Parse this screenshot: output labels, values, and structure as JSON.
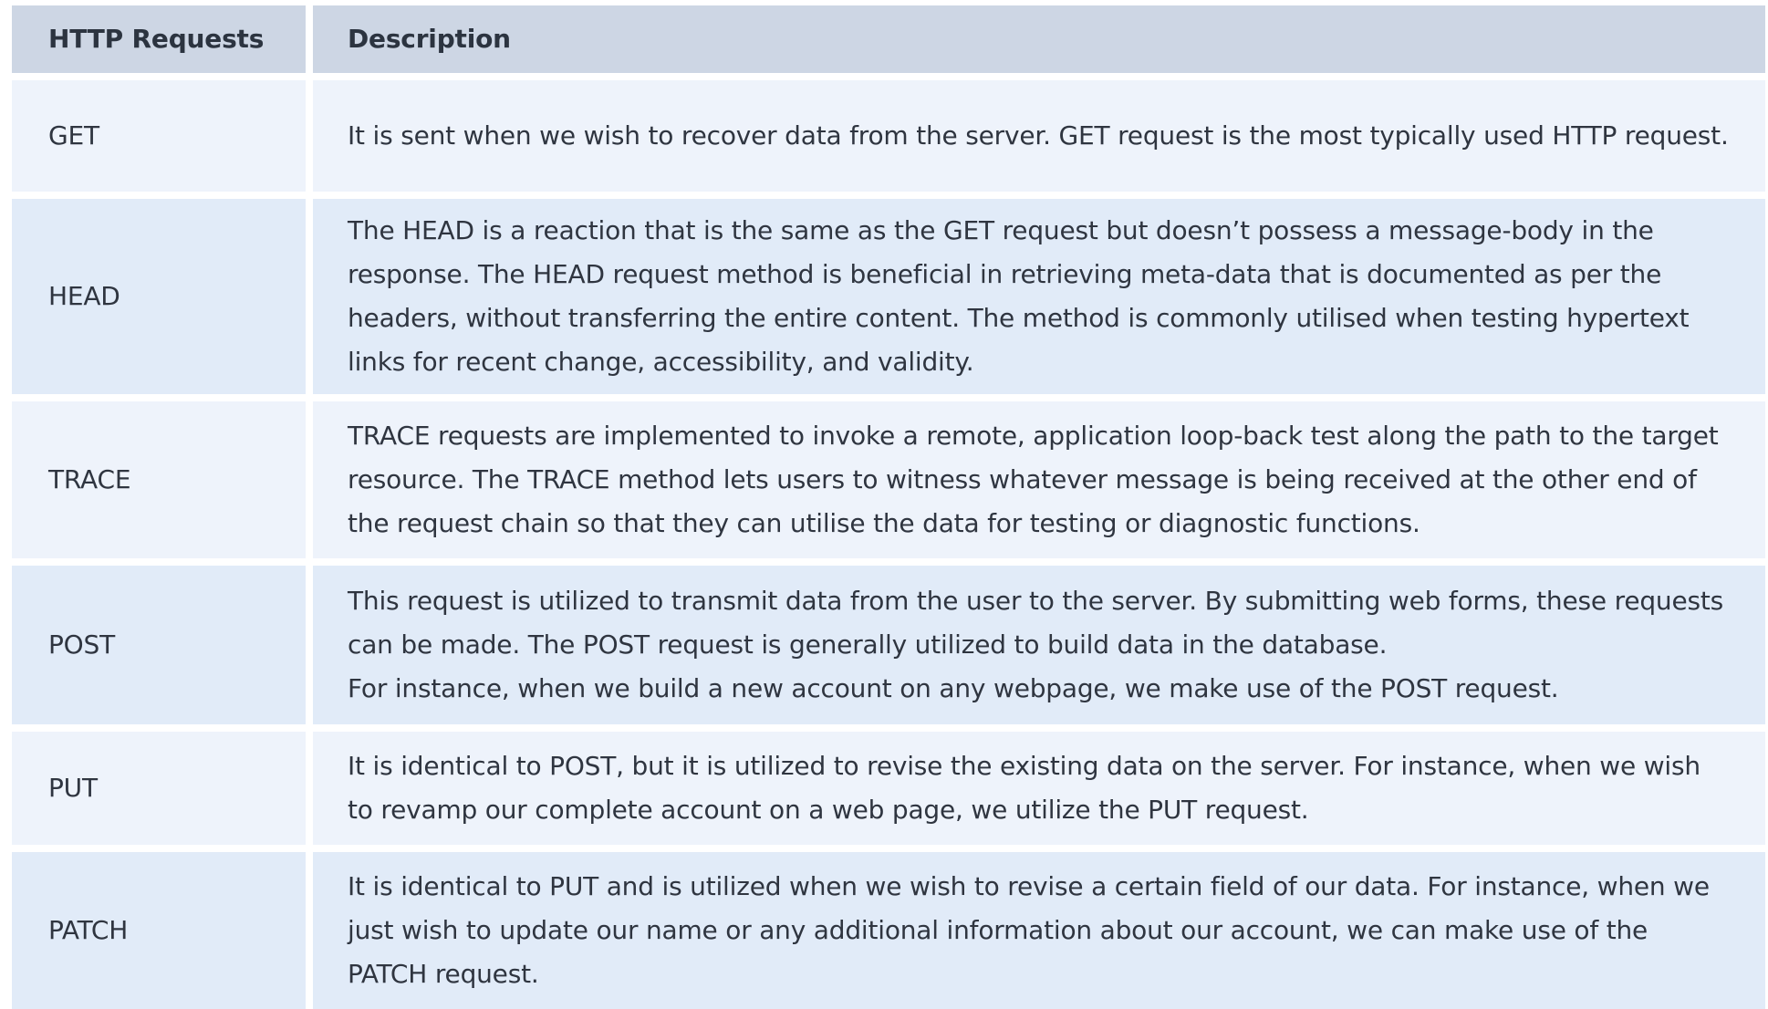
{
  "header": {
    "col1": "HTTP Requests",
    "col2": "Description"
  },
  "rows": [
    {
      "method": "GET",
      "description": "It is sent when we wish to recover data from the server. GET request is the most typically used HTTP request."
    },
    {
      "method": "HEAD",
      "description": "The HEAD is a reaction that is the same as the GET request but doesn’t possess a message-body in the response. The HEAD request method is beneficial in retrieving meta-data that is documented as per the headers, without transferring the entire content. The method is commonly utilised when testing hypertext links for recent change, accessibility, and validity."
    },
    {
      "method": "TRACE",
      "description": "TRACE requests are implemented to invoke a remote, application loop-back test along the path to the target resource. The TRACE method lets users to witness whatever message is being received at the other end of the request chain so that they can utilise the data for testing or diagnostic functions."
    },
    {
      "method": "POST",
      "description": "This request is utilized to transmit data from the user to the server. By submitting web forms, these requests can be made. The POST request is generally utilized to build data in the database.",
      "description_extra": "For instance, when we build a new account on any webpage, we make use of the POST request."
    },
    {
      "method": "PUT",
      "description": "It is identical to POST, but it is utilized to revise the existing data on the server. For instance, when we wish to revamp our complete account on a web page, we utilize the PUT request."
    },
    {
      "method": "PATCH",
      "description": "It is identical to PUT and is utilized when we wish to revise a certain field of our data. For instance, when we just wish to update our name or any additional information about our account, we can make use of the PATCH request."
    }
  ]
}
